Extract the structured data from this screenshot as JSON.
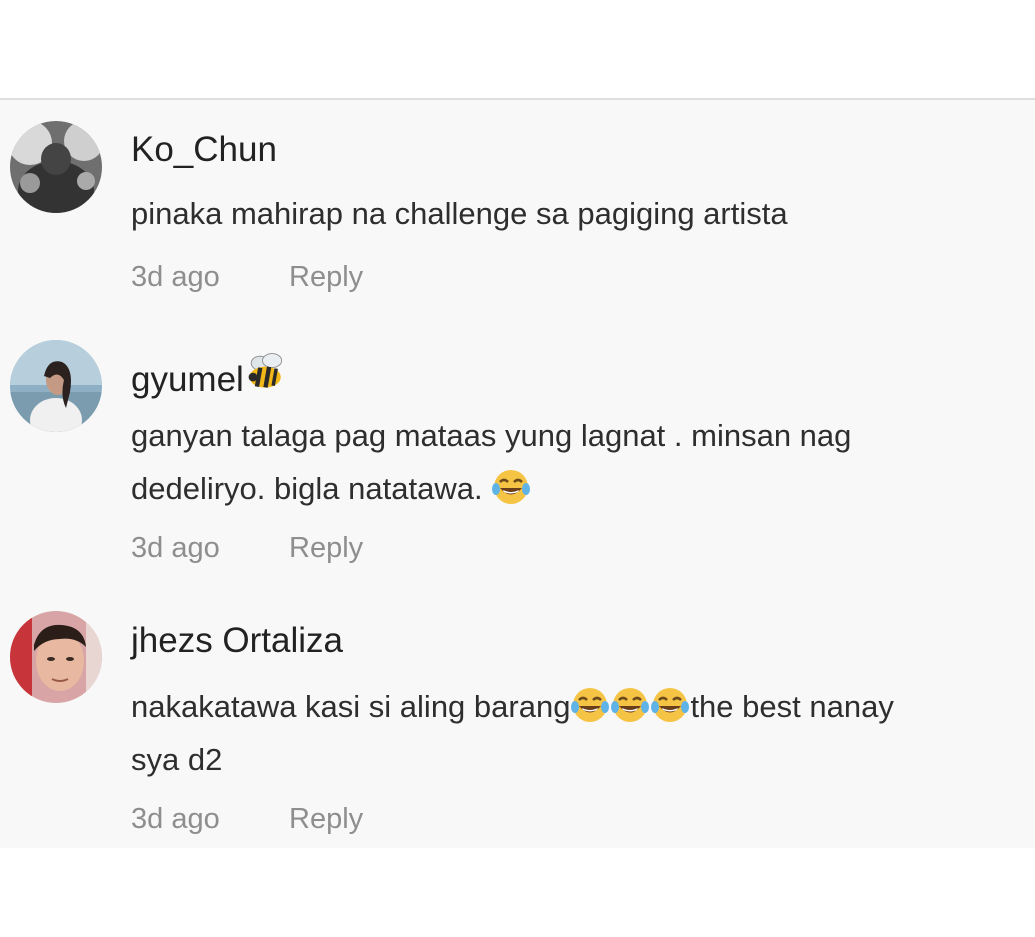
{
  "comments": [
    {
      "username": "Ko_Chun",
      "username_emoji": "",
      "text": "pinaka mahirap na challenge sa pagiging artista",
      "time": "3d ago",
      "reply_label": "Reply"
    },
    {
      "username": "gyumel",
      "username_emoji": "bee-emoji",
      "text_lines": [
        "ganyan talaga pag mataas yung lagnat . minsan nag",
        "dedeliryo. bigla natatawa."
      ],
      "text_emoji": "face-with-tears-of-joy-emoji",
      "time": "3d ago",
      "reply_label": "Reply"
    },
    {
      "username": "jhezs Ortaliza",
      "username_emoji": "",
      "text_before": "nakakatawa kasi si aling barang",
      "text_emoji_count": 3,
      "text_after": "the best nanay",
      "text_line2": "sya d2",
      "time": "3d ago",
      "reply_label": "Reply"
    }
  ],
  "colors": {
    "background": "#f8f8f8",
    "username": "#222222",
    "text": "#2e2e2e",
    "meta": "#8e8e8e"
  }
}
